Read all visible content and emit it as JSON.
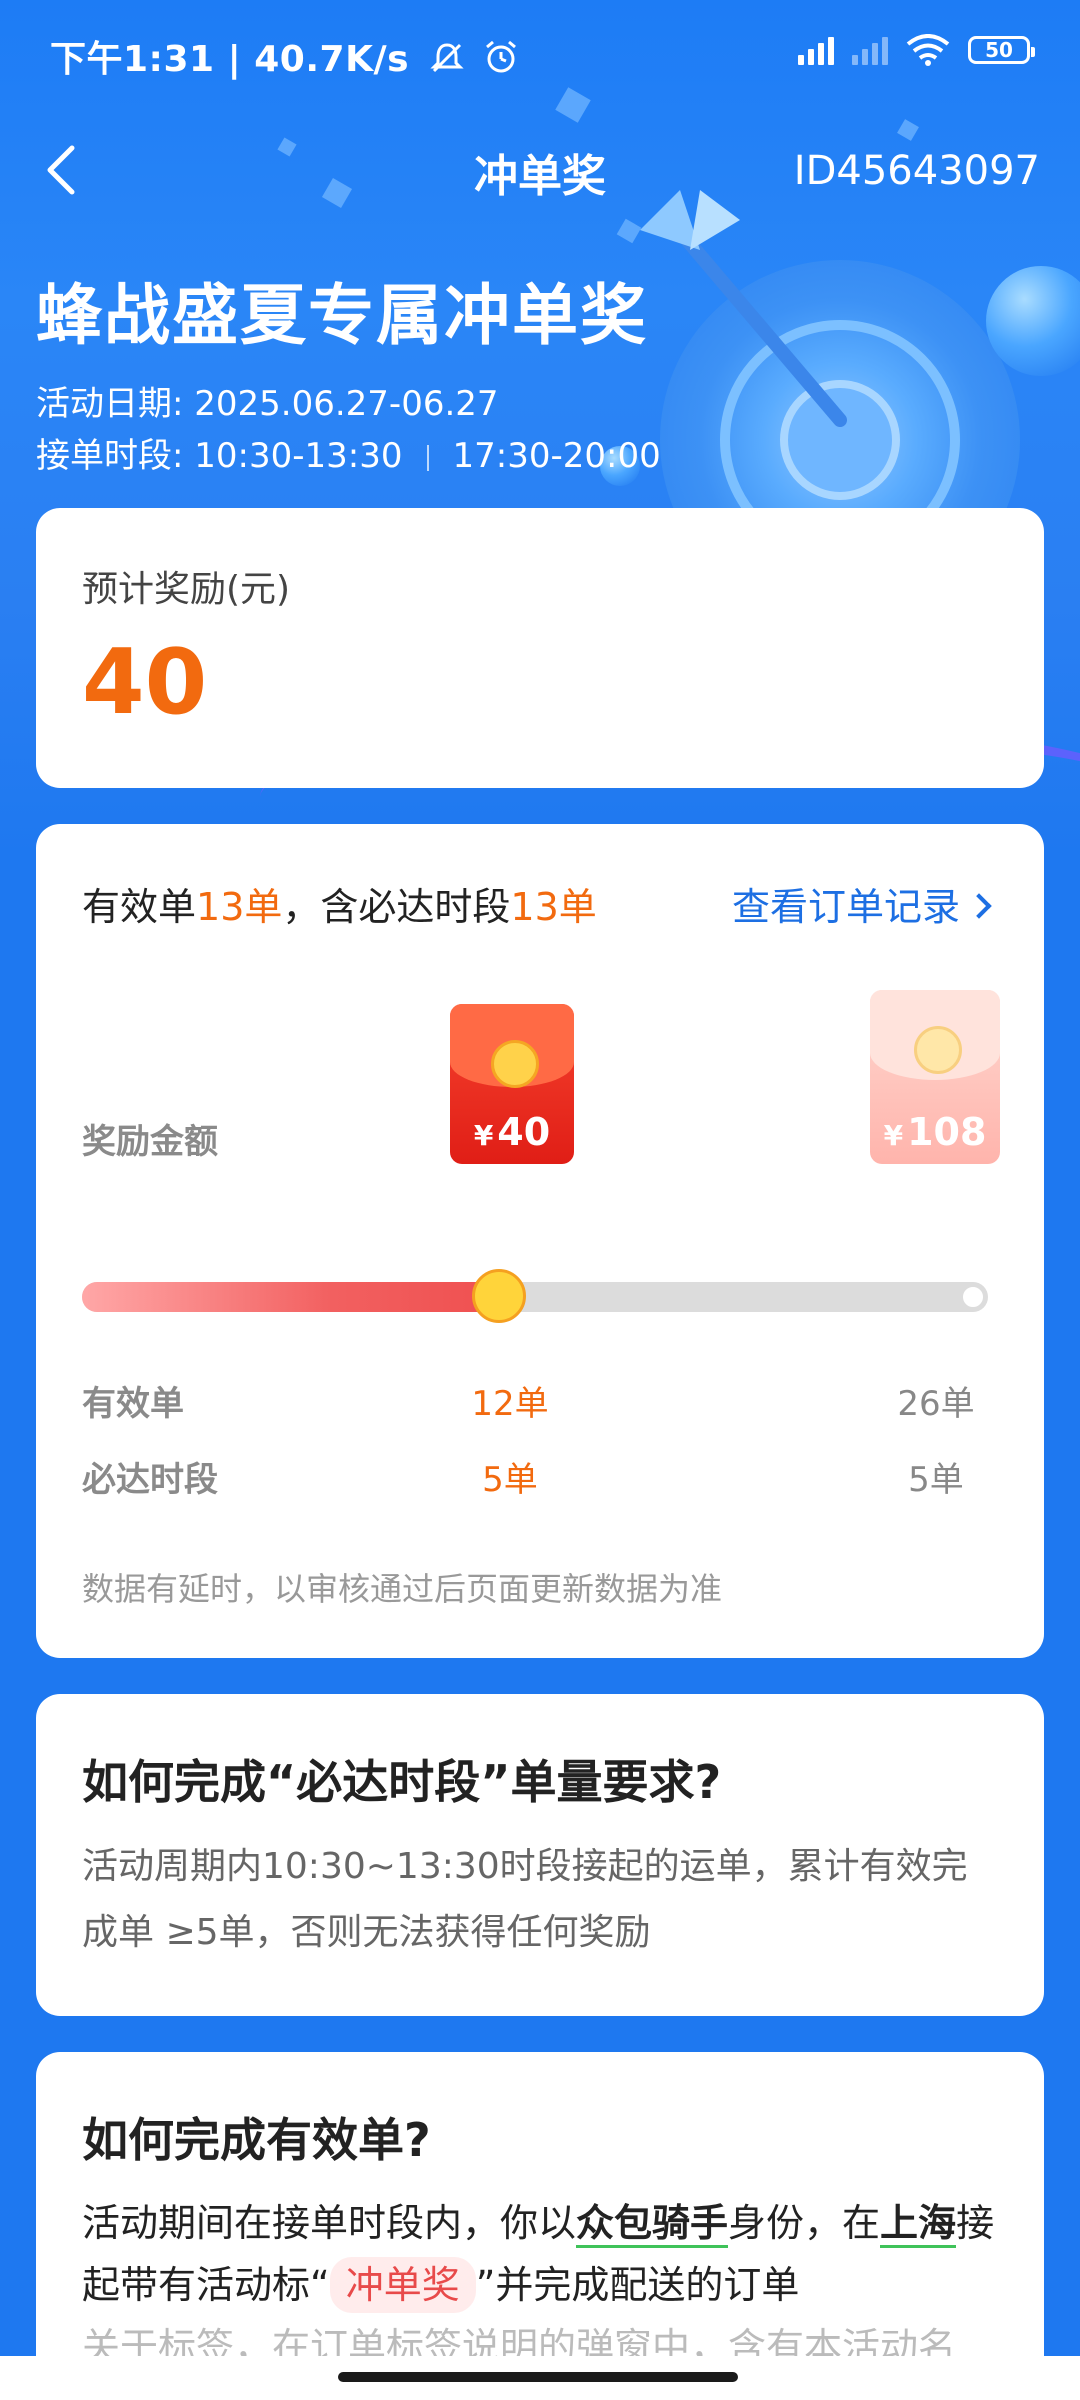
{
  "status_bar": {
    "time": "下午1:31 | 40.7K/s",
    "battery": "50"
  },
  "nav": {
    "title": "冲单奖",
    "id_text": "ID45643097"
  },
  "hero": {
    "title": "蜂战盛夏专属冲单奖",
    "date_label": "活动日期: ",
    "date_value": "2025.06.27-06.27",
    "slot_label": "接单时段: ",
    "slot_1": "10:30-13:30",
    "slot_2": "17:30-20:00"
  },
  "reward": {
    "label": "预计奖励(元)",
    "value": "40"
  },
  "progress": {
    "head_prefix": "有效单",
    "valid_count": "13单",
    "head_middle": "，含必达时段",
    "must_count": "13单",
    "link_label": "查看订单记录",
    "reward_row_label": "奖励金额",
    "tiers": [
      {
        "currency": "¥",
        "amount": "40",
        "valid": "12单",
        "must": "5单",
        "active": true
      },
      {
        "currency": "¥",
        "amount": "108",
        "valid": "26单",
        "must": "5单",
        "active": false
      }
    ],
    "valid_row_label": "有效单",
    "must_row_label": "必达时段",
    "progress_fraction": 0.46,
    "note": "数据有延时，以审核通过后页面更新数据为准"
  },
  "faq1": {
    "title": "如何完成“必达时段”单量要求?",
    "body": "活动周期内10:30~13:30时段接起的运单，累计有效完成单 ≥5单，否则无法获得任何奖励"
  },
  "faq2": {
    "title": "如何完成有效单?",
    "p1": "活动期间在接单时段内，你以",
    "role": "众包骑手",
    "p2": "身份，在",
    "city": "上海",
    "p3": "接起带有活动标“",
    "tag": "冲单奖",
    "p4": "”并完成配送的订单",
    "p5_faded": "关于标签，在订单标签说明的弹窗中，含有本活动名"
  },
  "colors": {
    "accent_orange": "#f26a0f",
    "link_blue": "#1d6fe3",
    "hero_blue": "#1e78f0"
  }
}
